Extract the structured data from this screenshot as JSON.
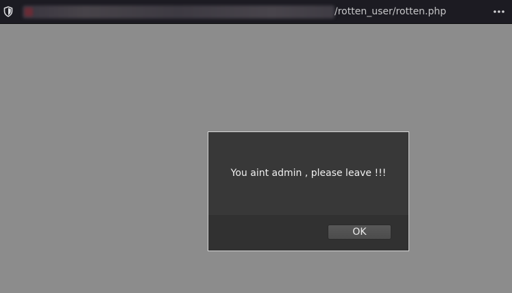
{
  "browser": {
    "url_visible_suffix": "/rotten_user/rotten.php",
    "icons": {
      "tracking_protection": "shield-icon",
      "page_actions": "more-dots-icon"
    }
  },
  "dialog": {
    "message": "You aint admin , please leave !!!",
    "ok_label": "OK"
  },
  "colors": {
    "page_background": "#8c8c8c",
    "toolbar_background": "#1c1b22",
    "dialog_background": "#383838",
    "dialog_border": "#d6d6d6"
  }
}
